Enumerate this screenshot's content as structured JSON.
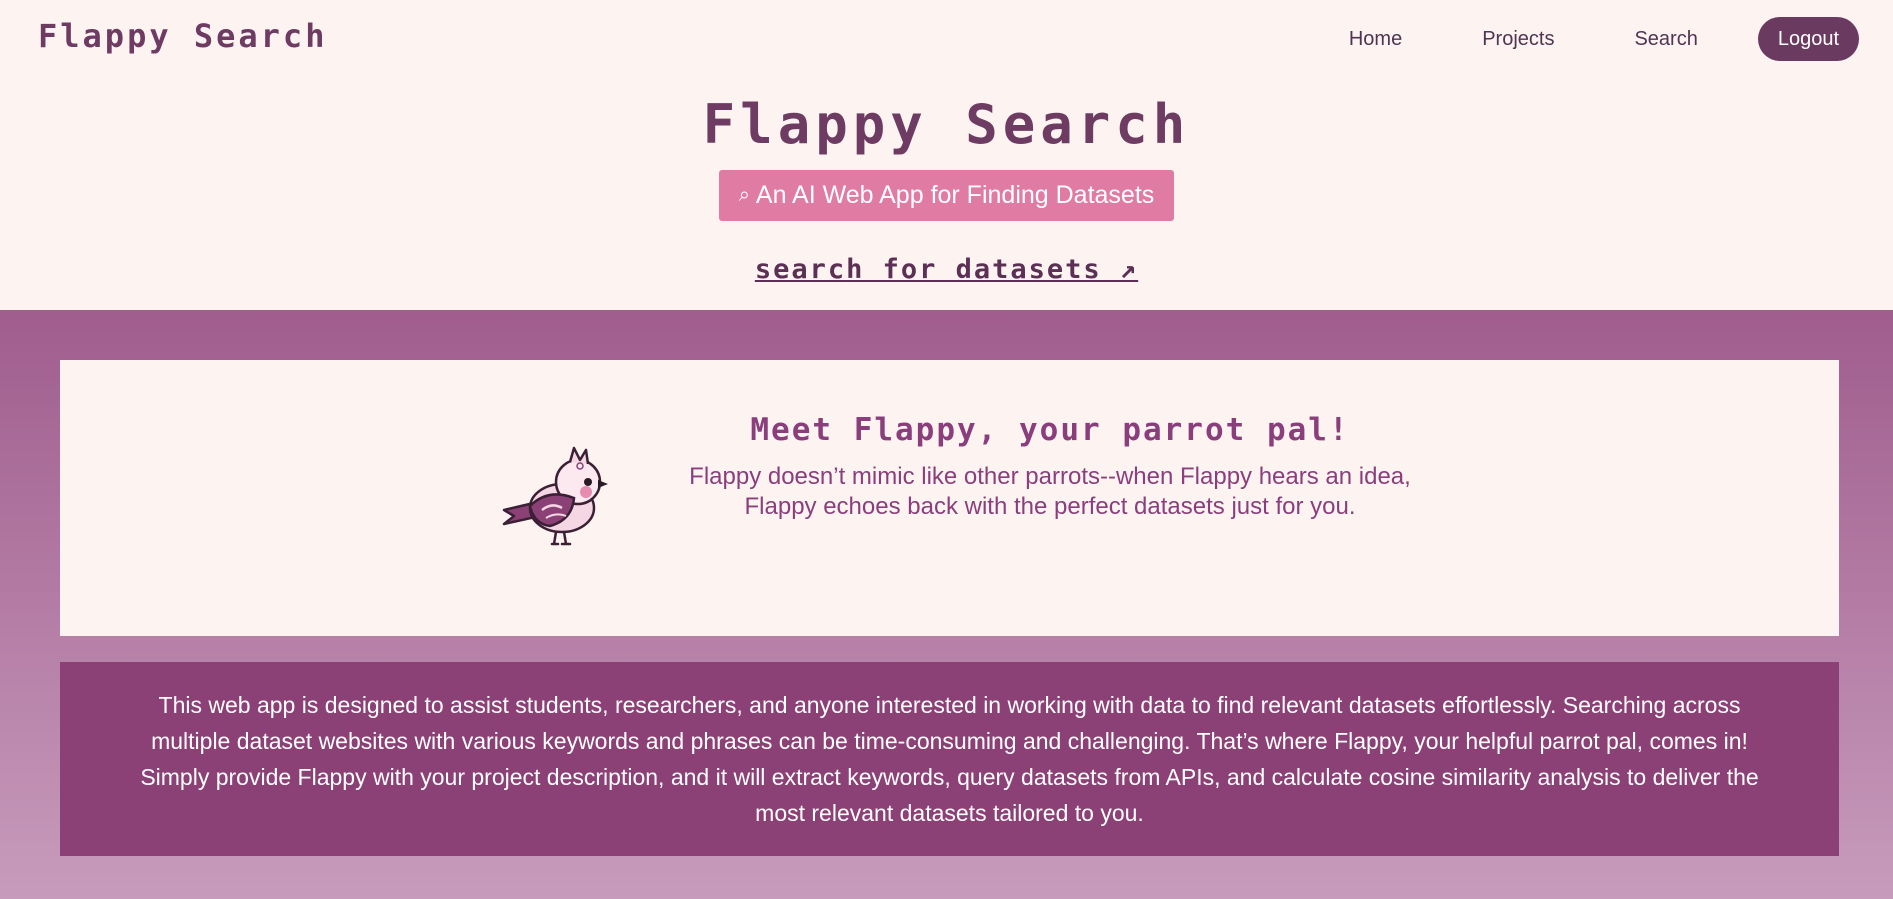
{
  "nav": {
    "brand": "Flappy Search",
    "links": [
      "Home",
      "Projects",
      "Search"
    ],
    "logout_label": "Logout"
  },
  "hero": {
    "title": "Flappy Search",
    "tagline_icon": "⌕",
    "tagline": "An AI Web App for Finding Datasets",
    "search_link": "search for datasets ↗"
  },
  "card": {
    "mascot_icon": "parrot-mascot",
    "title": "Meet Flappy, your parrot pal!",
    "body": "Flappy doesn’t mimic like other parrots--when Flappy hears an idea, Flappy echoes back with the perfect datasets just for you."
  },
  "info": {
    "text": "This web app is designed to assist students, researchers, and anyone interested in working with data to find relevant datasets effortlessly. Searching across multiple dataset websites with various keywords and phrases can be time-consuming and challenging. That’s where Flappy, your helpful parrot pal, comes in! Simply provide Flappy with your project description, and it will extract keywords, query datasets from APIs, and calculate cosine similarity analysis to deliver the most relevant datasets tailored to you."
  },
  "colors": {
    "background": "#fdf4f1",
    "brand_purple": "#6e3b62",
    "tagline_pink": "#e07ba3",
    "band_top": "#a05d8e",
    "band_bottom": "#c79bbb",
    "info_box": "#8b4176"
  }
}
